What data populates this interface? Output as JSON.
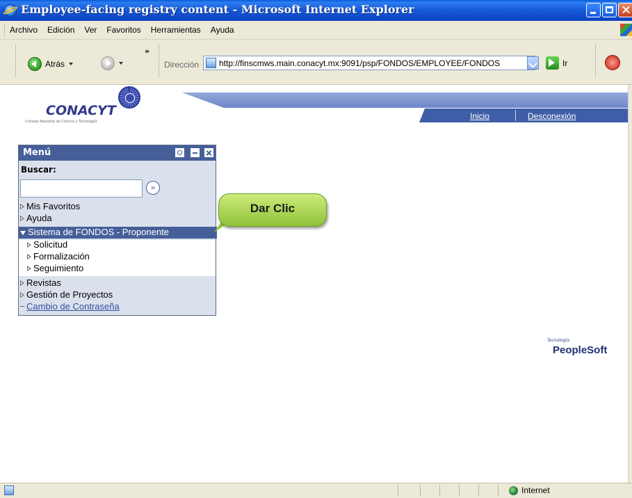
{
  "window": {
    "title": "Employee-facing registry content - Microsoft Internet Explorer"
  },
  "menubar": [
    "Archivo",
    "Edición",
    "Ver",
    "Favoritos",
    "Herramientas",
    "Ayuda"
  ],
  "toolbar": {
    "back_label": "Atrás",
    "address_label": "Dirección",
    "address_value": "http://finscmws.main.conacyt.mx:9091/psp/FONDOS/EMPLOYEE/FONDOS",
    "go_label": "Ir"
  },
  "header": {
    "logo_text": "CONACYT",
    "logo_subtitle": "Consejo Nacional de Ciencia y Tecnología",
    "nav_inicio": "Inicio",
    "nav_desconexion": "Desconexión"
  },
  "menu": {
    "title": "Menú",
    "search_label": "Buscar:",
    "search_value": "",
    "items": [
      {
        "label": "Mis Favoritos"
      },
      {
        "label": "Ayuda"
      },
      {
        "label": "Sistema de FONDOS - Proponente"
      },
      {
        "label": "Solicitud"
      },
      {
        "label": "Formalización"
      },
      {
        "label": "Seguimiento"
      },
      {
        "label": "Revistas"
      },
      {
        "label": "Gestión de Proyectos"
      },
      {
        "label": "Cambio de Contraseña"
      }
    ]
  },
  "callout": {
    "text": "Dar Clic"
  },
  "footer_brand": {
    "small": "Tecnología",
    "brand": "PeopleSoft"
  },
  "statusbar": {
    "zone": "Internet"
  },
  "colors": {
    "titlebar": "#0b4fd0",
    "menu_header": "#465f99",
    "callout": "#a9d356",
    "nav_band": "#3f5ea8"
  }
}
